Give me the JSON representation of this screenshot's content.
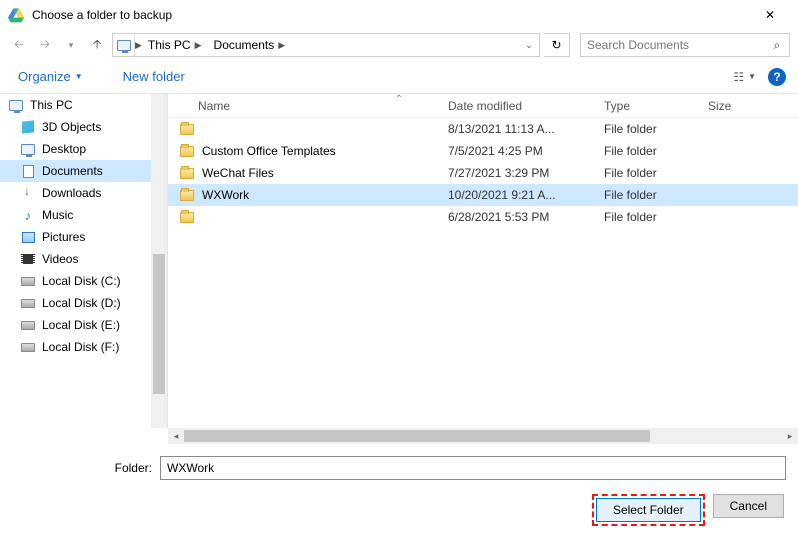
{
  "title": "Choose a folder to backup",
  "path": {
    "root": "This PC",
    "segment": "Documents"
  },
  "search": {
    "placeholder": "Search Documents"
  },
  "toolbar": {
    "organize": "Organize",
    "new_folder": "New folder"
  },
  "columns": {
    "name": "Name",
    "date": "Date modified",
    "type": "Type",
    "size": "Size"
  },
  "tree": [
    {
      "label": "This PC",
      "icon": "monitor"
    },
    {
      "label": "3D Objects",
      "icon": "cube"
    },
    {
      "label": "Desktop",
      "icon": "monitor"
    },
    {
      "label": "Documents",
      "icon": "doc",
      "selected": true
    },
    {
      "label": "Downloads",
      "icon": "dl"
    },
    {
      "label": "Music",
      "icon": "music"
    },
    {
      "label": "Pictures",
      "icon": "pic"
    },
    {
      "label": "Videos",
      "icon": "vid"
    },
    {
      "label": "Local Disk (C:)",
      "icon": "disk"
    },
    {
      "label": "Local Disk (D:)",
      "icon": "disk"
    },
    {
      "label": "Local Disk (E:)",
      "icon": "disk"
    },
    {
      "label": "Local Disk (F:)",
      "icon": "disk"
    }
  ],
  "rows": [
    {
      "name": "",
      "date": "8/13/2021 11:13 A...",
      "type": "File folder"
    },
    {
      "name": "Custom Office Templates",
      "date": "7/5/2021 4:25 PM",
      "type": "File folder"
    },
    {
      "name": "WeChat Files",
      "date": "7/27/2021 3:29 PM",
      "type": "File folder"
    },
    {
      "name": "WXWork",
      "date": "10/20/2021 9:21 A...",
      "type": "File folder",
      "selected": true
    },
    {
      "name": "",
      "date": "6/28/2021 5:53 PM",
      "type": "File folder"
    }
  ],
  "folder_field": {
    "label": "Folder:",
    "value": "WXWork"
  },
  "buttons": {
    "select": "Select Folder",
    "cancel": "Cancel"
  }
}
